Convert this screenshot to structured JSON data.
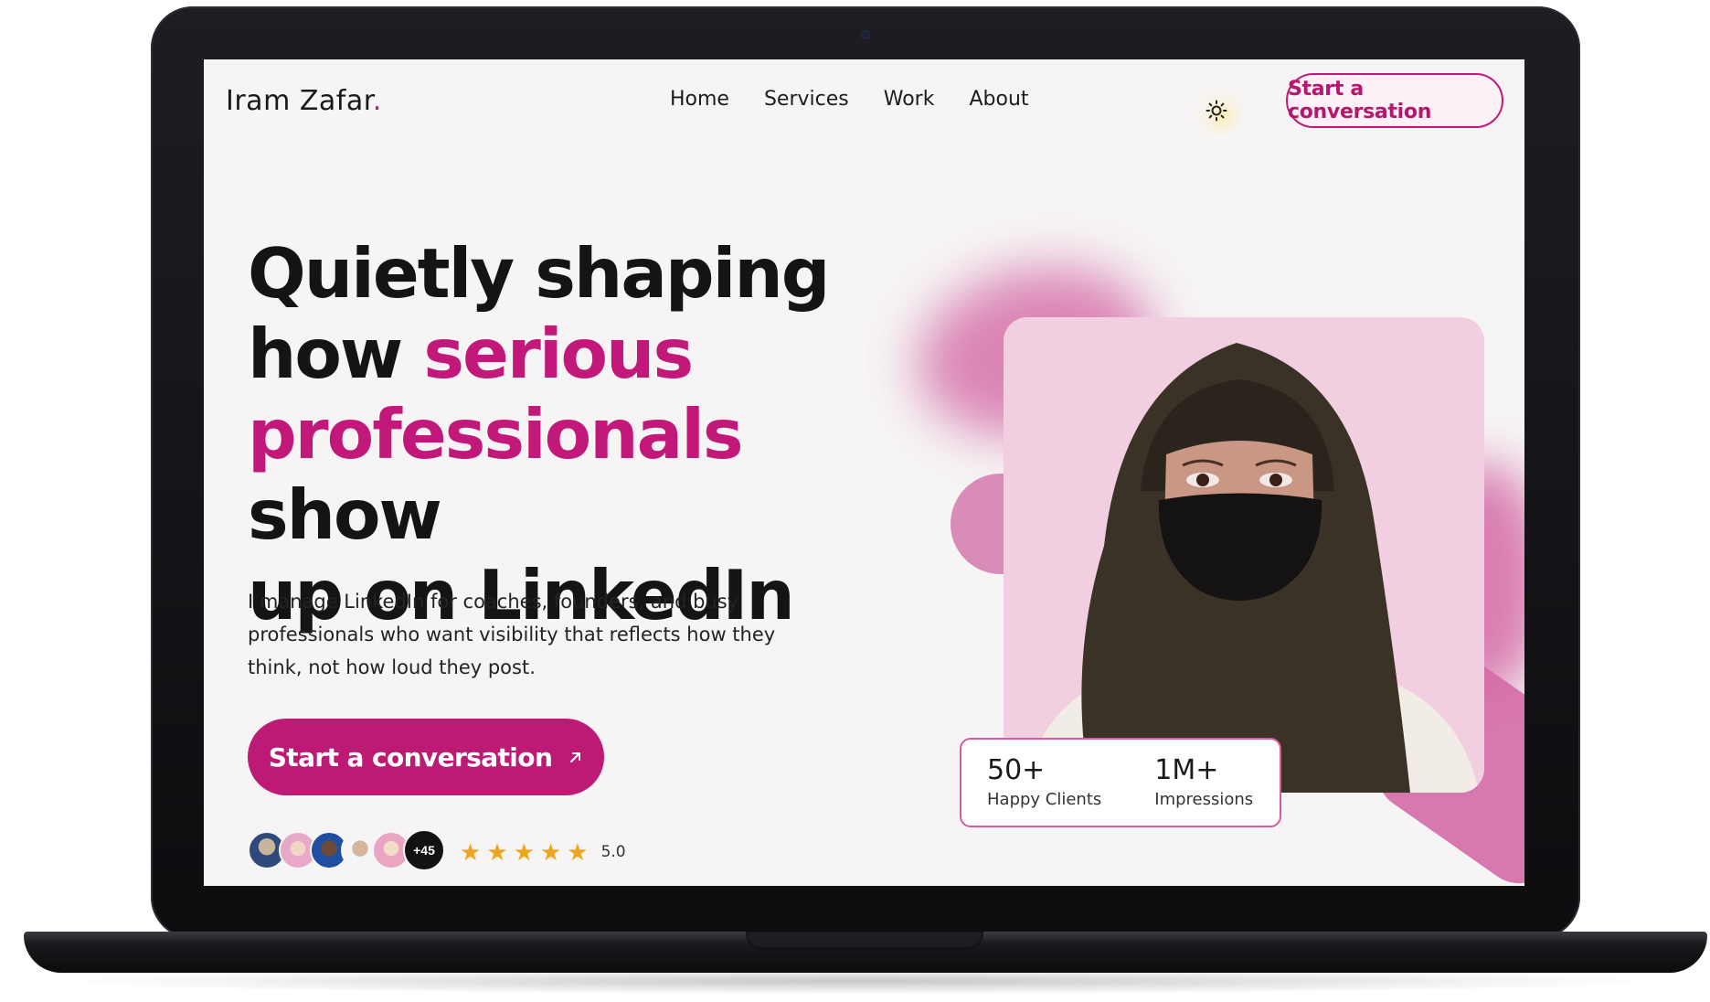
{
  "brand": {
    "name": "Iram Zafar",
    "dot": ".",
    "accent_color": "#c2187a"
  },
  "nav": {
    "items": [
      "Home",
      "Services",
      "Work",
      "About"
    ],
    "theme_icon": "sun-icon",
    "cta_label": "Start a conversation"
  },
  "hero": {
    "title_line1": "Quietly shaping",
    "title_how": "how ",
    "title_accent_1": "serious",
    "title_accent_2": "professionals",
    "title_show": " show",
    "title_line4": "up on LinkedIn",
    "subtitle": "I manage LinkedIn for coaches, founders, and busy professionals who want visibility that reflects how they think, not how loud they post.",
    "cta_label": "Start a conversation",
    "cta_icon": "arrow-up-right-icon"
  },
  "social_proof": {
    "avatar_count_label": "+45",
    "stars": 5,
    "rating": "5.0"
  },
  "stats": [
    {
      "value": "50+",
      "label": "Happy Clients"
    },
    {
      "value": "1M+",
      "label": "Impressions"
    }
  ]
}
